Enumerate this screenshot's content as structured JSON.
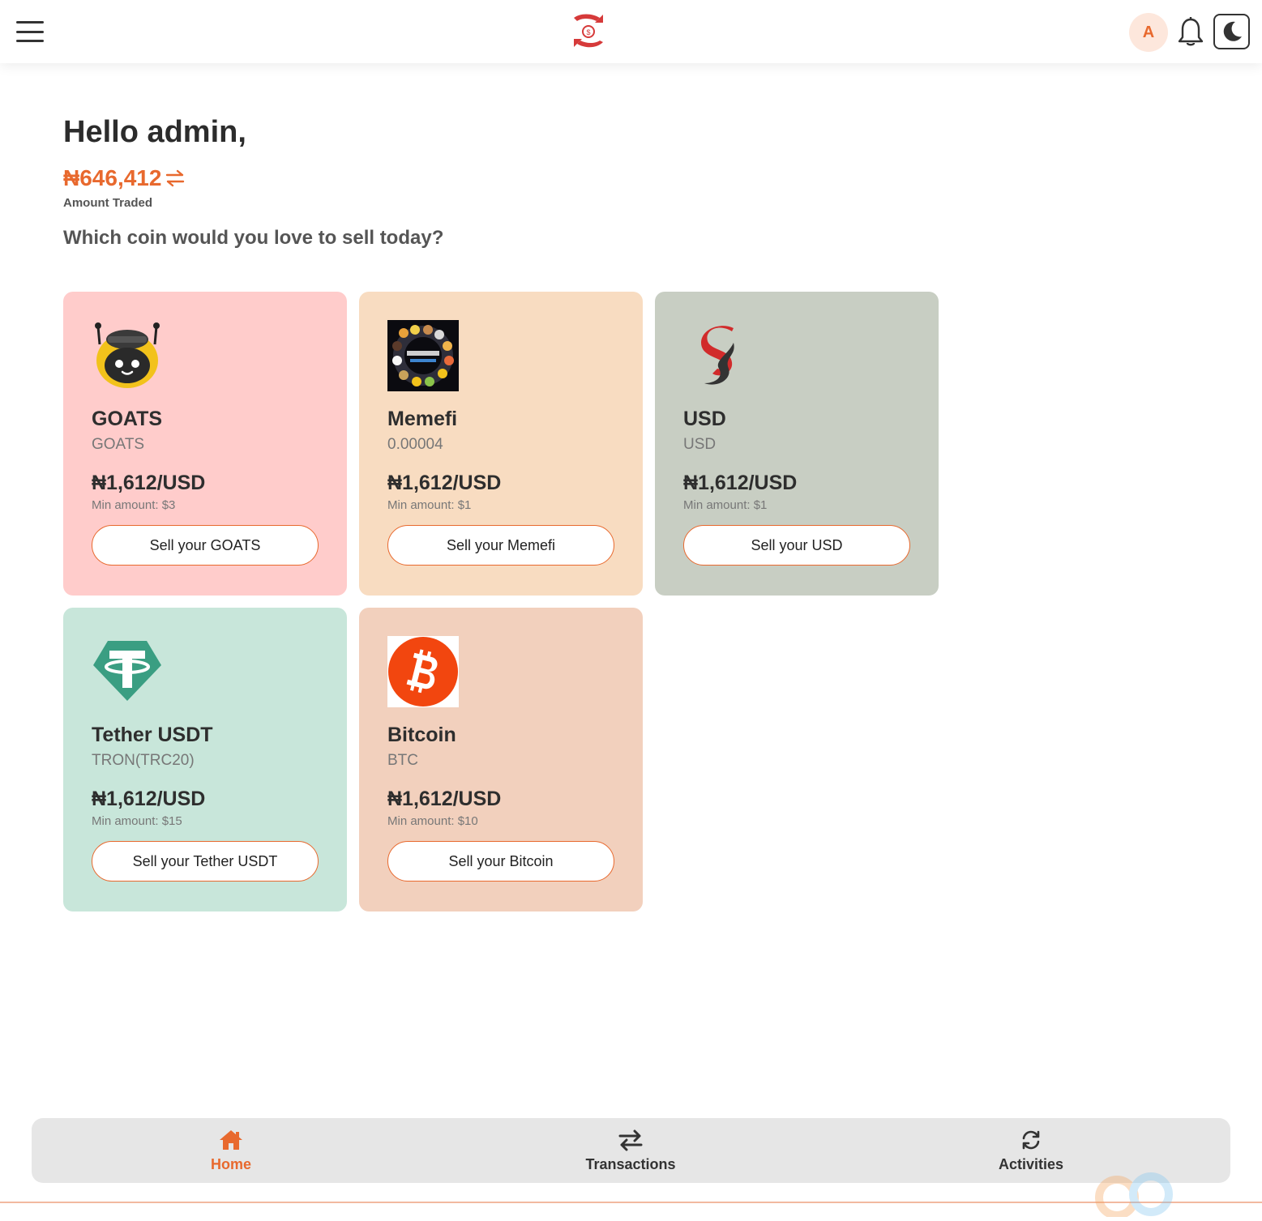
{
  "header": {
    "avatar_initial": "A"
  },
  "greeting": {
    "title": "Hello admin,",
    "amount": "₦646,412",
    "amount_label": "Amount Traded",
    "question": "Which coin would you love to sell today?"
  },
  "coins": [
    {
      "name": "GOATS",
      "network": "GOATS",
      "rate": "₦1,612/USD",
      "min": "Min amount: $3",
      "button": "Sell your GOATS",
      "bg": "#ffcccb",
      "icon": "goats-robot-icon"
    },
    {
      "name": "Memefi",
      "network": "0.00004",
      "rate": "₦1,612/USD",
      "min": "Min amount: $1",
      "button": "Sell your Memefi",
      "bg": "#f8dcc1",
      "icon": "memefi-icon"
    },
    {
      "name": "USD",
      "network": "USD",
      "rate": "₦1,612/USD",
      "min": "Min amount: $1",
      "button": "Sell your USD",
      "bg": "#c8cec3",
      "icon": "usd-s-logo-icon"
    },
    {
      "name": "Tether USDT",
      "network": "TRON(TRC20)",
      "rate": "₦1,612/USD",
      "min": "Min amount: $15",
      "button": "Sell your Tether USDT",
      "bg": "#c8e6da",
      "icon": "tether-icon"
    },
    {
      "name": "Bitcoin",
      "network": "BTC",
      "rate": "₦1,612/USD",
      "min": "Min amount: $10",
      "button": "Sell your Bitcoin",
      "bg": "#f2d0bd",
      "icon": "bitcoin-icon"
    }
  ],
  "nav": {
    "home": "Home",
    "transactions": "Transactions",
    "activities": "Activities"
  },
  "colors": {
    "accent": "#e8692e",
    "brand_red": "#d63a3a"
  }
}
